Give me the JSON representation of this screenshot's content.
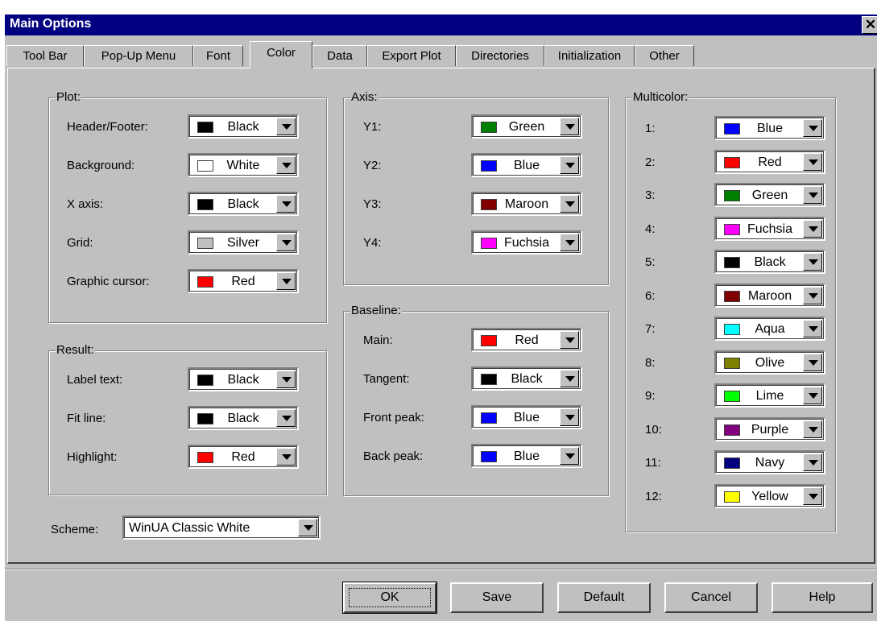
{
  "window": {
    "title": "Main Options"
  },
  "tabs": [
    "Tool Bar",
    "Pop-Up Menu",
    "Font",
    "Color",
    "Data",
    "Export Plot",
    "Directories",
    "Initialization",
    "Other"
  ],
  "active_tab": "Color",
  "plot": {
    "title": "Plot:",
    "rows": [
      {
        "label": "Header/Footer:",
        "value": "Black",
        "color": "#000000"
      },
      {
        "label": "Background:",
        "value": "White",
        "color": "#ffffff"
      },
      {
        "label": "X axis:",
        "value": "Black",
        "color": "#000000"
      },
      {
        "label": "Grid:",
        "value": "Silver",
        "color": "#c0c0c0"
      },
      {
        "label": "Graphic cursor:",
        "value": "Red",
        "color": "#ff0000"
      }
    ]
  },
  "result": {
    "title": "Result:",
    "rows": [
      {
        "label": "Label text:",
        "value": "Black",
        "color": "#000000"
      },
      {
        "label": "Fit line:",
        "value": "Black",
        "color": "#000000"
      },
      {
        "label": "Highlight:",
        "value": "Red",
        "color": "#ff0000"
      }
    ]
  },
  "axis": {
    "title": "Axis:",
    "rows": [
      {
        "label": "Y1:",
        "value": "Green",
        "color": "#008000"
      },
      {
        "label": "Y2:",
        "value": "Blue",
        "color": "#0000ff"
      },
      {
        "label": "Y3:",
        "value": "Maroon",
        "color": "#800000"
      },
      {
        "label": "Y4:",
        "value": "Fuchsia",
        "color": "#ff00ff"
      }
    ]
  },
  "baseline": {
    "title": "Baseline:",
    "rows": [
      {
        "label": "Main:",
        "value": "Red",
        "color": "#ff0000"
      },
      {
        "label": "Tangent:",
        "value": "Black",
        "color": "#000000"
      },
      {
        "label": "Front peak:",
        "value": "Blue",
        "color": "#0000ff"
      },
      {
        "label": "Back peak:",
        "value": "Blue",
        "color": "#0000ff"
      }
    ]
  },
  "multicolor": {
    "title": "Multicolor:",
    "rows": [
      {
        "label": "1:",
        "value": "Blue",
        "color": "#0000ff"
      },
      {
        "label": "2:",
        "value": "Red",
        "color": "#ff0000"
      },
      {
        "label": "3:",
        "value": "Green",
        "color": "#008000"
      },
      {
        "label": "4:",
        "value": "Fuchsia",
        "color": "#ff00ff"
      },
      {
        "label": "5:",
        "value": "Black",
        "color": "#000000"
      },
      {
        "label": "6:",
        "value": "Maroon",
        "color": "#800000"
      },
      {
        "label": "7:",
        "value": "Aqua",
        "color": "#00ffff"
      },
      {
        "label": "8:",
        "value": "Olive",
        "color": "#808000"
      },
      {
        "label": "9:",
        "value": "Lime",
        "color": "#00ff00"
      },
      {
        "label": "10:",
        "value": "Purple",
        "color": "#800080"
      },
      {
        "label": "11:",
        "value": "Navy",
        "color": "#000080"
      },
      {
        "label": "12:",
        "value": "Yellow",
        "color": "#ffff00"
      }
    ]
  },
  "scheme": {
    "label": "Scheme:",
    "value": "WinUA Classic White"
  },
  "buttons": {
    "ok": "OK",
    "save": "Save",
    "default": "Default",
    "cancel": "Cancel",
    "help": "Help"
  }
}
